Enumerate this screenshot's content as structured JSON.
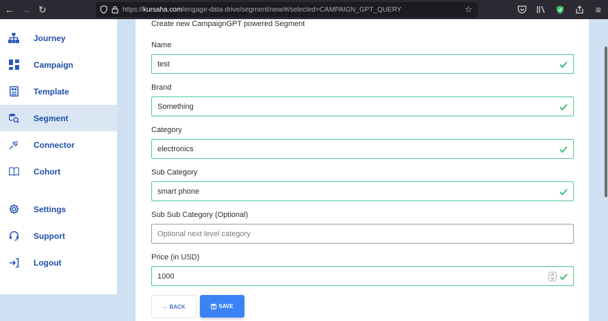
{
  "browser": {
    "url_prefix": "https://",
    "url_host": "kursaha.com",
    "url_path": "/engage-data-drive/segment/new/#/selected=CAMPAIGN_GPT_QUERY"
  },
  "sidebar": {
    "items": [
      {
        "label": "Journey",
        "icon": "sitemap-icon"
      },
      {
        "label": "Campaign",
        "icon": "dashboard-icon"
      },
      {
        "label": "Template",
        "icon": "template-icon"
      },
      {
        "label": "Segment",
        "icon": "segment-search-icon",
        "active": true
      },
      {
        "label": "Connector",
        "icon": "plug-icon"
      },
      {
        "label": "Cohort",
        "icon": "book-icon"
      },
      {
        "label": "Settings",
        "icon": "gear-icon"
      },
      {
        "label": "Support",
        "icon": "headset-icon"
      },
      {
        "label": "Logout",
        "icon": "logout-icon"
      }
    ]
  },
  "form": {
    "title": "Create new CampaignGPT powered Segment",
    "fields": [
      {
        "label": "Name",
        "value": "test",
        "valid": true
      },
      {
        "label": "Brand",
        "value": "Something",
        "valid": true
      },
      {
        "label": "Category",
        "value": "electronics",
        "valid": true
      },
      {
        "label": "Sub Category",
        "value": "smart phone",
        "valid": true
      },
      {
        "label": "Sub Sub Category (Optional)",
        "value": "",
        "placeholder": "Optional next level category",
        "valid": false
      },
      {
        "label": "Price (in USD)",
        "value": "1000",
        "valid": true
      }
    ],
    "back_label": "← BACK",
    "save_label": "SAVE"
  },
  "colors": {
    "accent": "#3b82f6",
    "sidebar_text": "#1f4fa8",
    "valid_border": "#4cc68d"
  }
}
